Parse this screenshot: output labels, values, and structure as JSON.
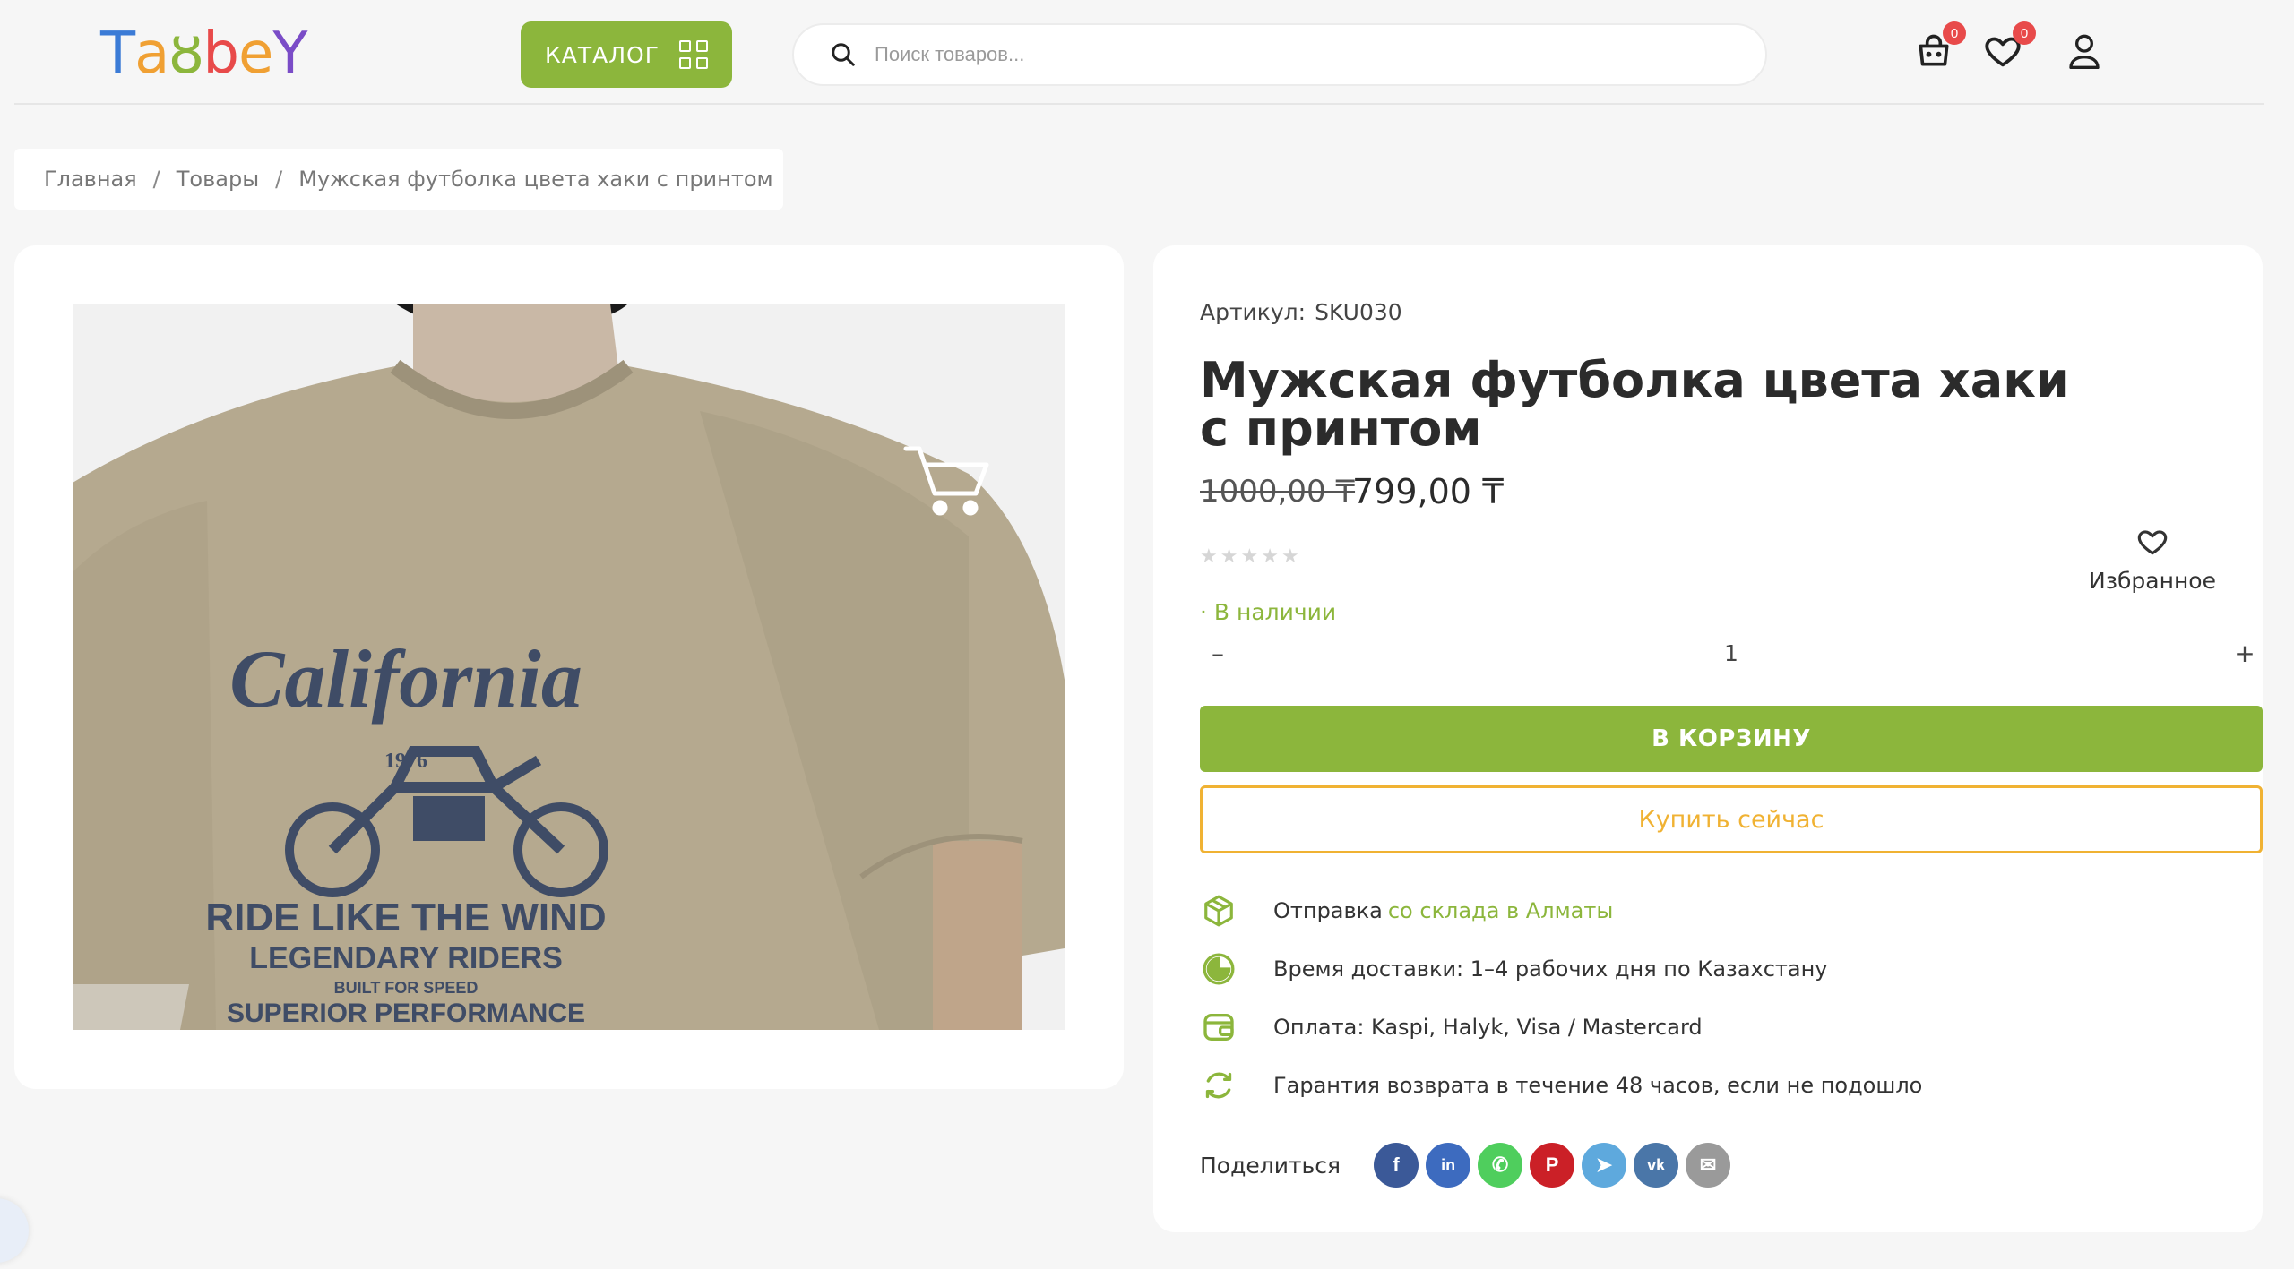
{
  "header": {
    "logo_letters": [
      {
        "ch": "T",
        "color": "#3b7bd6"
      },
      {
        "ch": "a",
        "color": "#f0a033"
      },
      {
        "ch": "ȣ",
        "color": "#8cb63c"
      },
      {
        "ch": "b",
        "color": "#e84a4a"
      },
      {
        "ch": "e",
        "color": "#f0a033"
      },
      {
        "ch": "Y",
        "color": "#7a4cc7"
      }
    ],
    "catalog_label": "КАТАЛОГ",
    "search_placeholder": "Поиск товаров...",
    "cart_count": "0",
    "wishlist_count": "0"
  },
  "breadcrumb": {
    "home": "Главная",
    "products": "Товары",
    "current": "Мужская футболка цвета хаки с принтом",
    "separator": "/"
  },
  "product": {
    "sku_label": "Артикул:",
    "sku": "SKU030",
    "title": "Мужская футболка цвета хаки с принтом",
    "old_price": "1000,00 ₸",
    "price": "799,00 ₸",
    "rating": 0,
    "rating_max": 5,
    "favorite_label": "Избранное",
    "stock": "· В наличии",
    "qty_minus": "–",
    "qty_value": "1",
    "qty_plus": "+",
    "add_to_cart": "В КОРЗИНУ",
    "buy_now": "Купить сейчас"
  },
  "tshirt_print": {
    "line1": "California",
    "year": "1976",
    "line2": "RIDE LIKE THE WIND",
    "line3": "LEGENDARY RIDERS",
    "line4": "BUILT FOR SPEED",
    "line5": "SUPERIOR PERFORMANCE"
  },
  "features": [
    {
      "icon": "box-icon",
      "text": "Отправка ",
      "highlight": "со склада в Алматы"
    },
    {
      "icon": "clock-icon",
      "text": "Время доставки: 1–4 рабочих дня по Казахстану",
      "highlight": ""
    },
    {
      "icon": "wallet-icon",
      "text": "Оплата: Kaspi, Halyk, Visa / Mastercard",
      "highlight": ""
    },
    {
      "icon": "refresh-icon",
      "text": "Гарантия возврата в течение 48 часов, если не подошло",
      "highlight": ""
    }
  ],
  "share": {
    "label": "Поделиться",
    "networks": [
      {
        "name": "facebook-icon",
        "glyph": "f",
        "color": "#3b5998"
      },
      {
        "name": "linkedin-icon",
        "glyph": "in",
        "color": "#3d6bbf"
      },
      {
        "name": "whatsapp-icon",
        "glyph": "✆",
        "color": "#4fce5d"
      },
      {
        "name": "pinterest-icon",
        "glyph": "P",
        "color": "#cb2027"
      },
      {
        "name": "telegram-icon",
        "glyph": "➤",
        "color": "#5ea9dd"
      },
      {
        "name": "vk-icon",
        "glyph": "vk",
        "color": "#4a76a8"
      },
      {
        "name": "email-icon",
        "glyph": "✉",
        "color": "#9a9a9a"
      }
    ]
  },
  "colors": {
    "accent_green": "#8cb63c",
    "accent_orange": "#f0b233",
    "badge_red": "#e84a4a"
  }
}
